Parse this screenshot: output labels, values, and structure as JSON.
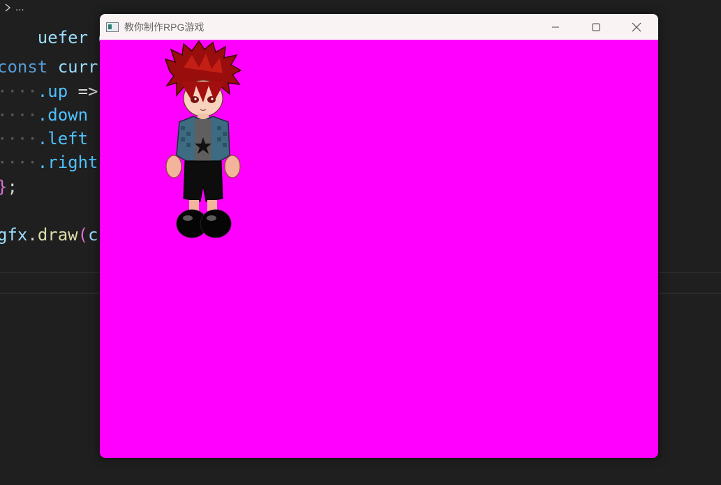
{
  "editor": {
    "breadcrumb": "...",
    "lines": [
      {
        "t": "uefer gfx."
      },
      {
        "kw": "const ",
        "var": "curr"
      },
      {
        "dots": "····",
        "prop": ".up",
        "op": " =>"
      },
      {
        "dots": "····",
        "prop": ".down"
      },
      {
        "dots": "····",
        "prop": ".left"
      },
      {
        "dots": "····",
        "prop": ".right"
      },
      {
        "paren": "}",
        "op": ";"
      },
      {
        "var": "gfx",
        "op": ".",
        "fn": "draw",
        "paren": "(",
        "var2": "c"
      }
    ]
  },
  "window": {
    "title": "教你制作RPG游戏",
    "canvas_color": "#ff00ff",
    "buttons": {
      "minimize": "minimize-icon",
      "maximize": "maximize-icon",
      "close": "close-icon"
    }
  },
  "colors": {
    "editor_bg": "#1f1f1f",
    "titlebar_bg": "#f9f3f3",
    "canvas": "#ff00ff"
  }
}
